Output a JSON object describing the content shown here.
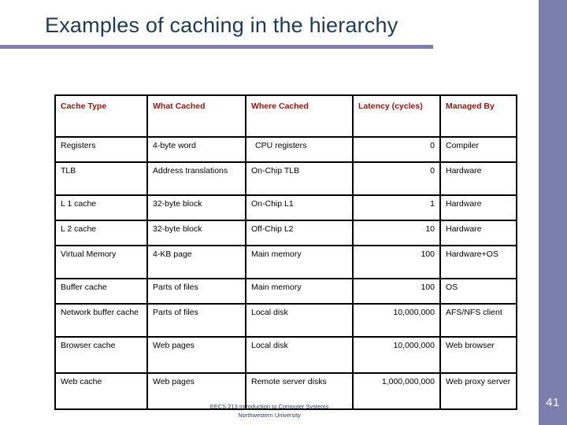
{
  "slide": {
    "title": "Examples of caching in the hierarchy",
    "page_number": "41",
    "accent_color": "#7b7fad",
    "title_color": "#1b3a5c",
    "header_text_color": "#9c1010"
  },
  "footer": {
    "line1": "EECS 213 Introduction to Computer Systems",
    "line2": "Northwestern University"
  },
  "chart_data": {
    "type": "table",
    "title": "Examples of caching in the hierarchy",
    "columns": [
      "Cache Type",
      "What Cached",
      "Where Cached",
      "Latency (cycles)",
      "Managed By"
    ],
    "rows": [
      [
        "Registers",
        "4-byte word",
        "CPU registers",
        "0",
        "Compiler"
      ],
      [
        "TLB",
        "Address translations",
        "On-Chip TLB",
        "0",
        "Hardware"
      ],
      [
        "L 1 cache",
        "32-byte block",
        "On-Chip L1",
        "1",
        "Hardware"
      ],
      [
        "L 2 cache",
        "32-byte block",
        "Off-Chip L2",
        "10",
        "Hardware"
      ],
      [
        "Virtual Memory",
        "4-KB page",
        "Main memory",
        "100",
        "Hardware+OS"
      ],
      [
        "Buffer cache",
        "Parts of files",
        "Main memory",
        "100",
        "OS"
      ],
      [
        "Network buffer cache",
        "Parts of files",
        "Local disk",
        "10,000,000",
        "AFS/NFS client"
      ],
      [
        "Browser cache",
        "Web pages",
        "Local disk",
        "10,000,000",
        "Web browser"
      ],
      [
        "Web cache",
        "Web pages",
        "Remote server disks",
        "1,000,000,000",
        "Web proxy server"
      ]
    ]
  }
}
